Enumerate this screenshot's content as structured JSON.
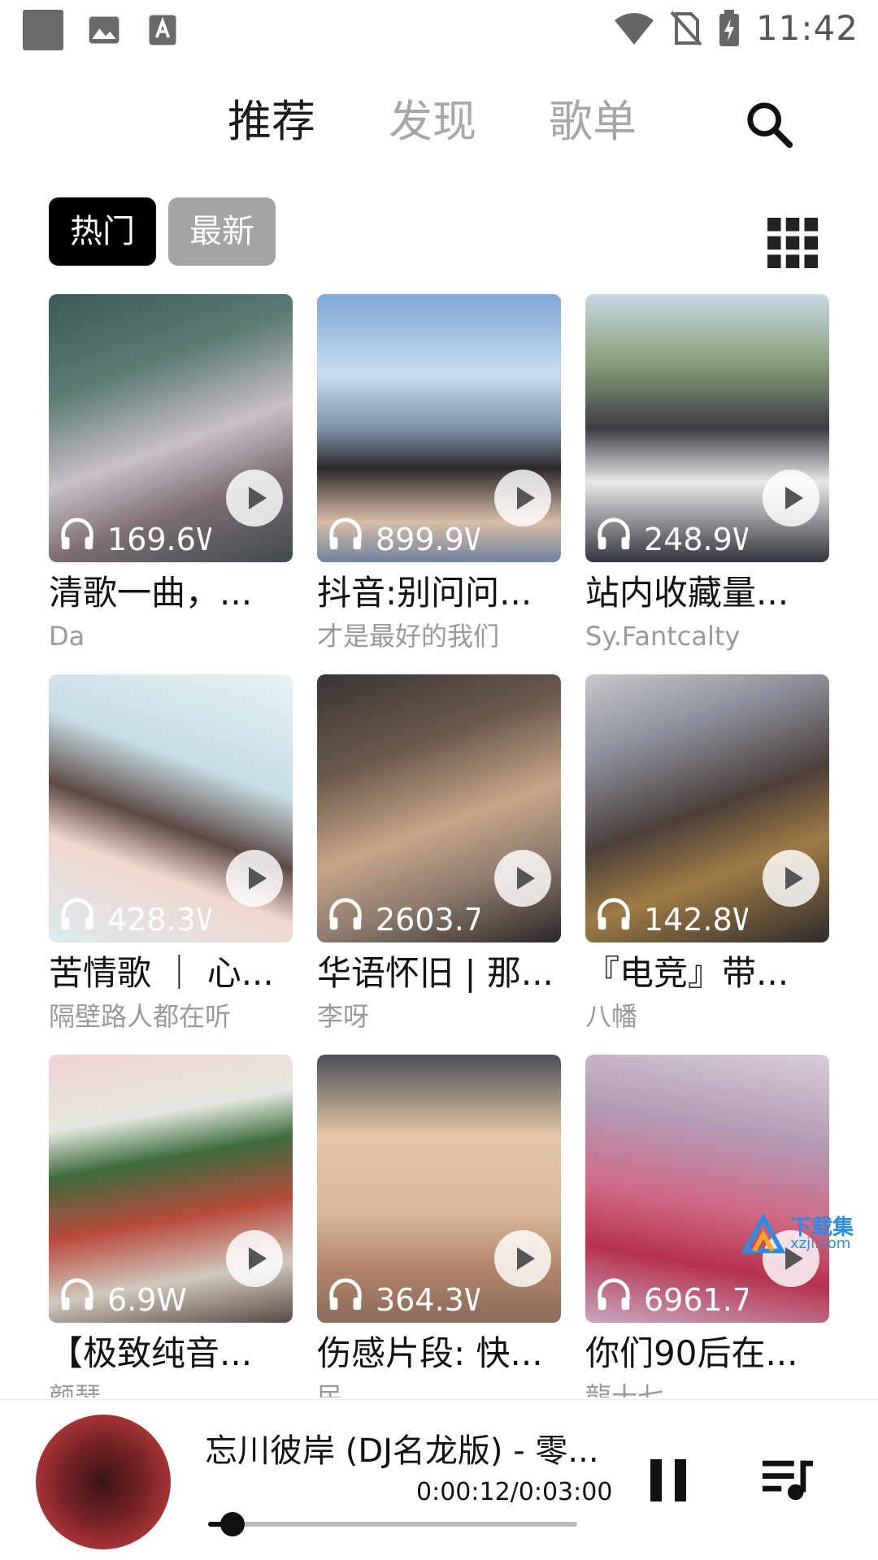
{
  "status_bar": {
    "time": "11:42",
    "left_icons": [
      "notification-square-icon",
      "image-icon",
      "text-icon"
    ],
    "right_icons": [
      "wifi-icon",
      "no-sim-icon",
      "battery-charging-icon"
    ]
  },
  "tabs": [
    {
      "label": "推荐",
      "active": true
    },
    {
      "label": "发现",
      "active": false
    },
    {
      "label": "歌单",
      "active": false
    }
  ],
  "filters": [
    {
      "label": "热门",
      "active": true
    },
    {
      "label": "最新",
      "active": false
    }
  ],
  "playlists": [
    {
      "title": "清歌一曲，...",
      "author": "Da",
      "plays": "169.6W"
    },
    {
      "title": "抖音:别问问...",
      "author": "才是最好的我们",
      "plays": "899.9W"
    },
    {
      "title": "站内收藏量...",
      "author": "Sy.Fantcalty",
      "plays": "248.9W"
    },
    {
      "title": "苦情歌 ｜ 心...",
      "author": "隔壁路人都在听",
      "plays": "428.3W"
    },
    {
      "title": "华语怀旧 | 那...",
      "author": "李呀",
      "plays": "2603.7"
    },
    {
      "title": "『电竞』带...",
      "author": "八幡",
      "plays": "142.8W"
    },
    {
      "title": "【极致纯音...",
      "author": "颜瑟",
      "plays": "6.9W"
    },
    {
      "title": "伤感片段: 快...",
      "author": "民",
      "plays": "364.3W"
    },
    {
      "title": "你们90后在...",
      "author": "龍十七",
      "plays": "6961.7"
    }
  ],
  "watermark": {
    "line1": "下载集",
    "line2": "xzji.com"
  },
  "player": {
    "song_title": "忘川彼岸 (DJ名龙版) - 零...",
    "time": "0:00:12/0:03:00",
    "progress_fraction": 0.067
  },
  "colors": {
    "active_chip_bg": "#000000",
    "inactive_chip_bg": "#a4a4a4",
    "tab_active": "#1a1a1a",
    "tab_inactive": "#a6a6a6"
  }
}
